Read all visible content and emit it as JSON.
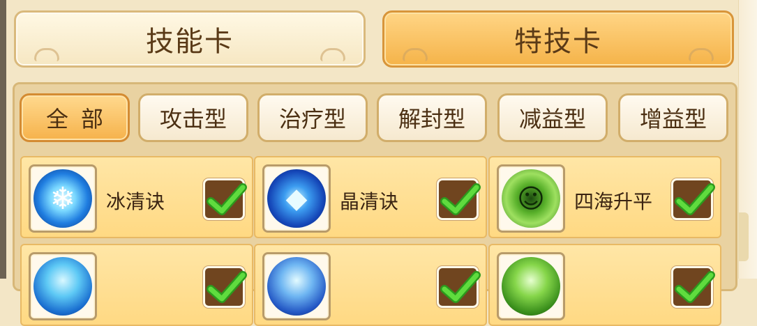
{
  "main_tabs": [
    {
      "label": "技能卡",
      "active": false
    },
    {
      "label": "特技卡",
      "active": true
    }
  ],
  "filters": [
    {
      "label": "全部",
      "active": true
    },
    {
      "label": "攻击型",
      "active": false
    },
    {
      "label": "治疗型",
      "active": false
    },
    {
      "label": "解封型",
      "active": false
    },
    {
      "label": "减益型",
      "active": false
    },
    {
      "label": "增益型",
      "active": false
    }
  ],
  "cards": [
    {
      "name": "冰清诀",
      "icon": "snowflake-icon",
      "checked": true
    },
    {
      "name": "晶清诀",
      "icon": "crystal-icon",
      "checked": true
    },
    {
      "name": "四海升平",
      "icon": "green-spirit-icon",
      "checked": true
    },
    {
      "name": "",
      "icon": "water-swirl-icon",
      "checked": true
    },
    {
      "name": "",
      "icon": "blue-wave-icon",
      "checked": true
    },
    {
      "name": "",
      "icon": "green-leaf-icon",
      "checked": true
    }
  ],
  "colors": {
    "background": "#f3e6c6",
    "active_tab": "#f5b349",
    "card": "#ffd983",
    "check": "#45c72d"
  }
}
